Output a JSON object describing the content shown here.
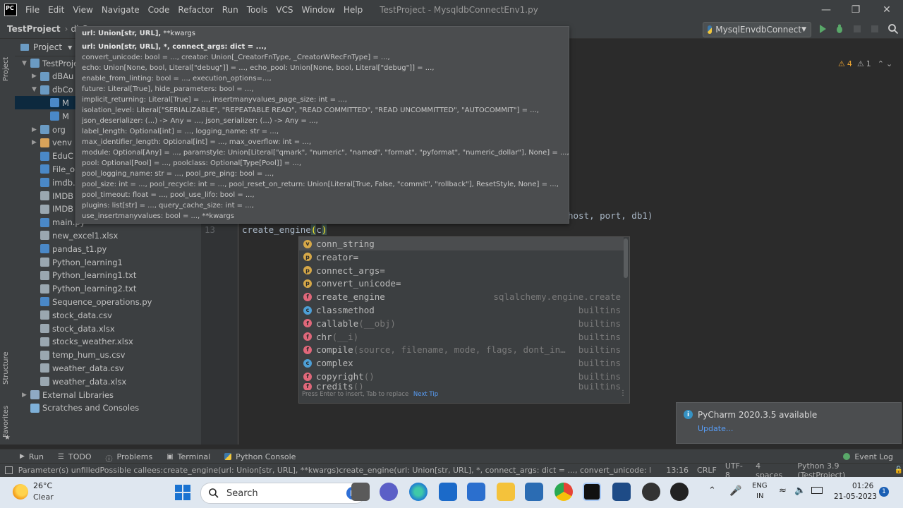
{
  "window": {
    "title": "TestProject - MysqldbConnectEnv1.py",
    "menu": [
      "File",
      "Edit",
      "View",
      "Navigate",
      "Code",
      "Refactor",
      "Run",
      "Tools",
      "VCS",
      "Window",
      "Help"
    ],
    "logo": "PC"
  },
  "navbar": {
    "project": "TestProject",
    "crumb2": "dbC",
    "run_config": "MysqlEnvdbConnect"
  },
  "inspections": {
    "warnings": "4",
    "weak": "1"
  },
  "project_panel": {
    "title": "Project",
    "items": [
      {
        "label": "TestProje",
        "indent": 1,
        "arrow": "▼",
        "icon": "folder"
      },
      {
        "label": "dBAu",
        "indent": 2,
        "arrow": "▶",
        "icon": "folder"
      },
      {
        "label": "dbCo",
        "indent": 2,
        "arrow": "▼",
        "icon": "folder"
      },
      {
        "label": "M",
        "indent": 3,
        "arrow": "",
        "icon": "py",
        "selected": true
      },
      {
        "label": "M",
        "indent": 3,
        "arrow": "",
        "icon": "py"
      },
      {
        "label": "org",
        "indent": 2,
        "arrow": "▶",
        "icon": "folder"
      },
      {
        "label": "venv",
        "indent": 2,
        "arrow": "▶",
        "icon": "folder-orange"
      },
      {
        "label": "EduC",
        "indent": 2,
        "arrow": "",
        "icon": "py"
      },
      {
        "label": "File_o",
        "indent": 2,
        "arrow": "",
        "icon": "py"
      },
      {
        "label": "imdb.",
        "indent": 2,
        "arrow": "",
        "icon": "py"
      },
      {
        "label": "IMDB",
        "indent": 2,
        "arrow": "",
        "icon": "file"
      },
      {
        "label": "IMDB",
        "indent": 2,
        "arrow": "",
        "icon": "file"
      },
      {
        "label": "main.py",
        "indent": 2,
        "arrow": "",
        "icon": "py"
      },
      {
        "label": "new_excel1.xlsx",
        "indent": 2,
        "arrow": "",
        "icon": "file"
      },
      {
        "label": "pandas_t1.py",
        "indent": 2,
        "arrow": "",
        "icon": "py"
      },
      {
        "label": "Python_learning1",
        "indent": 2,
        "arrow": "",
        "icon": "file"
      },
      {
        "label": "Python_learning1.txt",
        "indent": 2,
        "arrow": "",
        "icon": "file"
      },
      {
        "label": "Python_learning2.txt",
        "indent": 2,
        "arrow": "",
        "icon": "file"
      },
      {
        "label": "Sequence_operations.py",
        "indent": 2,
        "arrow": "",
        "icon": "py"
      },
      {
        "label": "stock_data.csv",
        "indent": 2,
        "arrow": "",
        "icon": "file"
      },
      {
        "label": "stock_data.xlsx",
        "indent": 2,
        "arrow": "",
        "icon": "file"
      },
      {
        "label": "stocks_weather.xlsx",
        "indent": 2,
        "arrow": "",
        "icon": "file"
      },
      {
        "label": "temp_hum_us.csv",
        "indent": 2,
        "arrow": "",
        "icon": "file"
      },
      {
        "label": "weather_data.csv",
        "indent": 2,
        "arrow": "",
        "icon": "file"
      },
      {
        "label": "weather_data.xlsx",
        "indent": 2,
        "arrow": "",
        "icon": "file"
      },
      {
        "label": "External Libraries",
        "indent": 1,
        "arrow": "▶",
        "icon": "lib"
      },
      {
        "label": "Scratches and Consoles",
        "indent": 1,
        "arrow": "",
        "icon": "scratch"
      }
    ]
  },
  "side_labels": {
    "project": "Project",
    "structure": "Structure",
    "favorites": "Favorites"
  },
  "editor": {
    "line_number": "13",
    "code_line": "create_engine(c)",
    "typed": "c",
    "code_above_tail": "host, port, db1)"
  },
  "tooltip": {
    "header_bold": "url: Union[str, URL],",
    "header_rest": " **kwargs",
    "lines": [
      "url: Union[str, URL], *, connect_args: dict = ...,",
      "convert_unicode: bool = ..., creator: Union[_CreatorFnType, _CreatorWRecFnType] = ...,",
      "echo: Union[None, bool, Literal[\"debug\"]] = ..., echo_pool: Union[None, bool, Literal[\"debug\"]] = ...,",
      "enable_from_linting: bool = ..., execution_options=...,",
      "future: Literal[True], hide_parameters: bool = ...,",
      "implicit_returning: Literal[True] = ..., insertmanyvalues_page_size: int = ...,",
      "isolation_level: Literal[\"SERIALIZABLE\", \"REPEATABLE READ\", \"READ COMMITTED\", \"READ UNCOMMITTED\", \"AUTOCOMMIT\"] = ...,",
      "json_deserializer: (...) -> Any = ..., json_serializer: (...) -> Any = ...,",
      "label_length: Optional[int] = ..., logging_name: str = ...,",
      "max_identifier_length: Optional[int] = ..., max_overflow: int = ...,",
      "module: Optional[Any] = ..., paramstyle: Union[Literal[\"qmark\", \"numeric\", \"named\", \"format\", \"pyformat\", \"numeric_dollar\"], None] = ...,",
      "pool: Optional[Pool] = ..., poolclass: Optional[Type[Pool]] = ...,",
      "pool_logging_name: str = ..., pool_pre_ping: bool = ...,",
      "pool_size: int = ..., pool_recycle: int = ..., pool_reset_on_return: Union[Literal[True, False, \"commit\", \"rollback\"], ResetStyle, None] = ...,",
      "pool_timeout: float = ..., pool_use_lifo: bool = ...,",
      "plugins: list[str] = ..., query_cache_size: int = ...,",
      "use_insertmanyvalues: bool = ..., **kwargs"
    ]
  },
  "completion": {
    "items": [
      {
        "kind": "v",
        "name": "conn_string",
        "params": "",
        "source": "",
        "selected": true
      },
      {
        "kind": "p",
        "name": "creator=",
        "params": "",
        "source": ""
      },
      {
        "kind": "p",
        "name": "connect_args=",
        "params": "",
        "source": ""
      },
      {
        "kind": "p",
        "name": "convert_unicode=",
        "params": "",
        "source": ""
      },
      {
        "kind": "f",
        "name": "create_engine",
        "params": "",
        "source": "sqlalchemy.engine.create"
      },
      {
        "kind": "c",
        "name": "classmethod",
        "params": "",
        "source": "builtins"
      },
      {
        "kind": "f",
        "name": "callable",
        "params": "(__obj)",
        "source": "builtins"
      },
      {
        "kind": "f",
        "name": "chr",
        "params": "(__i)",
        "source": "builtins"
      },
      {
        "kind": "f",
        "name": "compile",
        "params": "(source, filename, mode, flags, dont_in…",
        "source": "builtins"
      },
      {
        "kind": "c",
        "name": "complex",
        "params": "",
        "source": "builtins"
      },
      {
        "kind": "f",
        "name": "copyright",
        "params": "()",
        "source": "builtins"
      },
      {
        "kind": "f",
        "name": "credits",
        "params": "()",
        "source": "builtins"
      }
    ],
    "footer": "Press Enter to insert, Tab to replace",
    "footer_link": "Next Tip"
  },
  "notification": {
    "title": "PyCharm 2020.3.5 available",
    "link": "Update..."
  },
  "bottom_tools": [
    "Run",
    "TODO",
    "Problems",
    "Terminal",
    "Python Console"
  ],
  "event_log": "Event Log",
  "status": {
    "message": "Parameter(s) unfilledPossible callees:create_engine(url: Union[str, URL], **kwargs)create_engine(url: Union[str, URL], *, connect_args: dict = ..., convert_unicode: bool = ..., creator: Unio...",
    "position": "13:16",
    "line_sep": "CRLF",
    "encoding": "UTF-8",
    "indent": "4 spaces",
    "interpreter": "Python 3.9 (TestProject)"
  },
  "taskbar": {
    "weather_temp": "26°C",
    "weather_desc": "Clear",
    "search": "Search",
    "lang1": "ENG",
    "lang2": "IN",
    "time": "01:26",
    "date": "21-05-2023",
    "notif_count": "1"
  },
  "colors": {
    "accent": "#3592c4",
    "selected_row": "#0d293e",
    "warning": "#f0a732",
    "run_green": "#59a869"
  }
}
